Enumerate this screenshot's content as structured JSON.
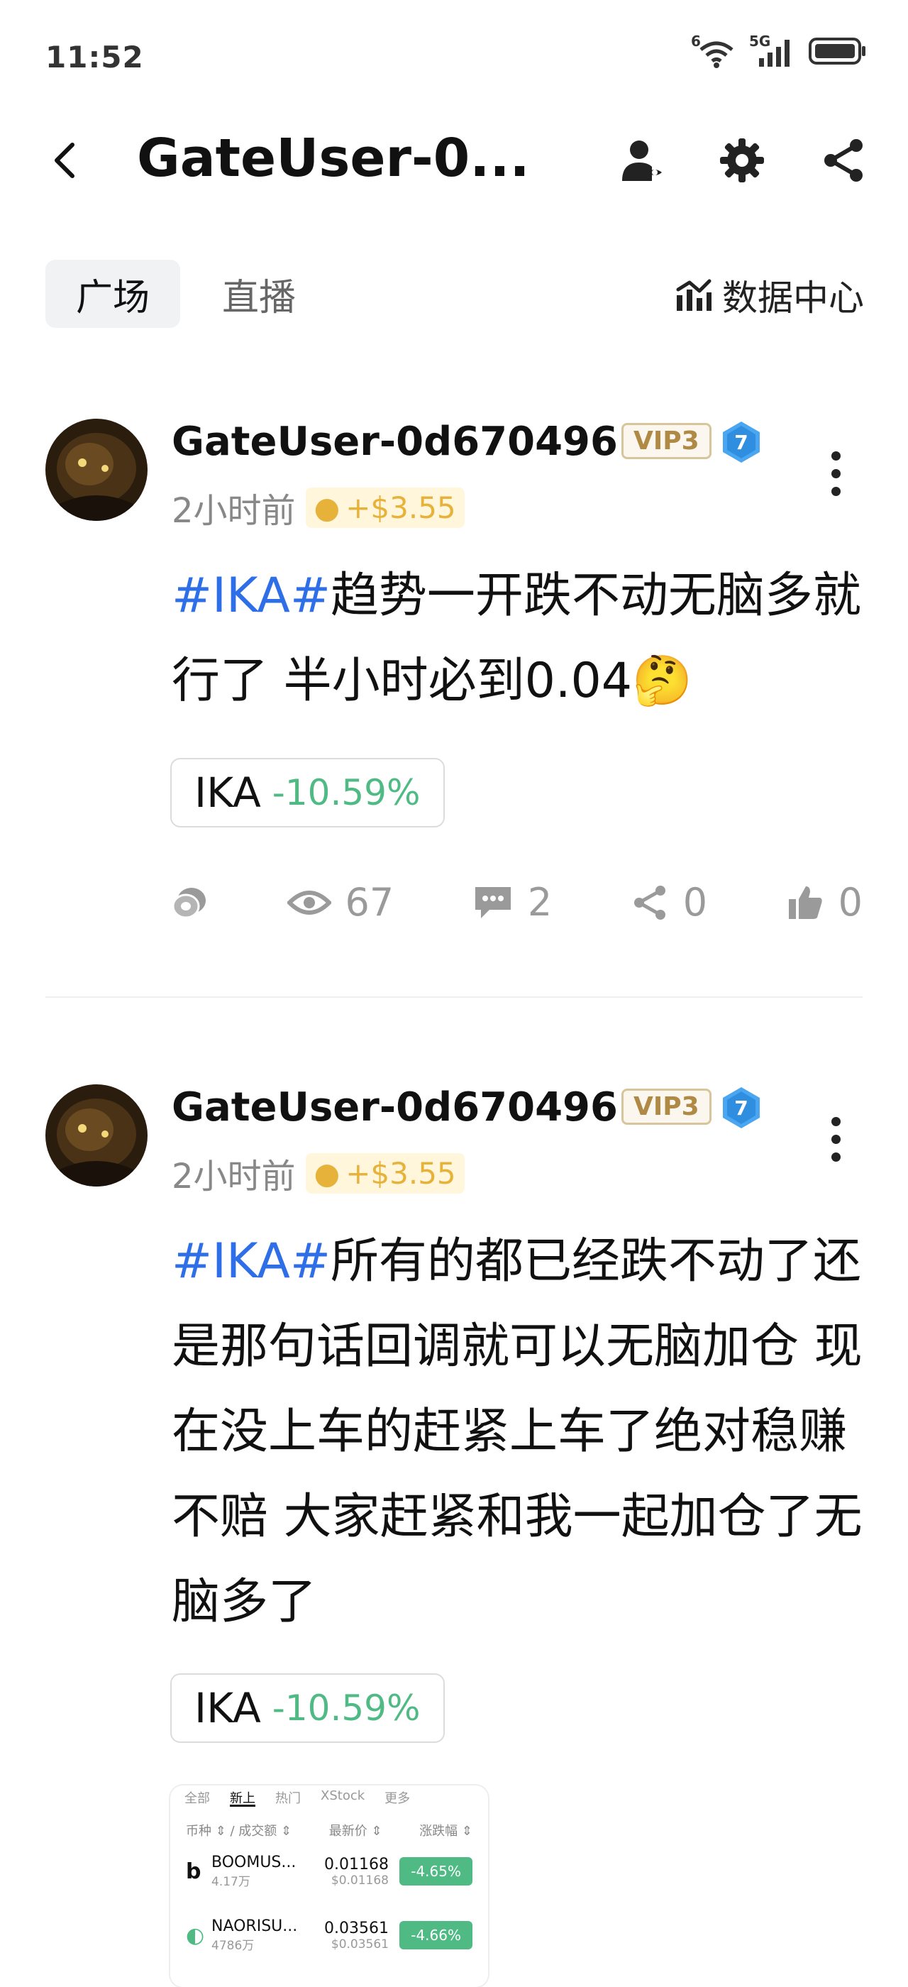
{
  "status": {
    "time": "11:52",
    "net1": "6",
    "net2": "5G"
  },
  "header": {
    "title": "GateUser-0..."
  },
  "tabs": [
    {
      "label": "广场"
    },
    {
      "label": "直播"
    }
  ],
  "data_center": {
    "label": "数据中心"
  },
  "posts": [
    {
      "username": "GateUser-0d670496",
      "vip": "VIP3",
      "level": "7",
      "time": "2小时前",
      "tip": "+$3.55",
      "hashtag": "#IKA#",
      "text": "趋势一开跌不动无脑多就行了 半小时必到0.04",
      "emoji": "🤔",
      "coin": {
        "name": "IKA",
        "change": "-10.59%"
      },
      "views": "67",
      "comments": "2",
      "shares": "0",
      "likes": "0"
    },
    {
      "username": "GateUser-0d670496",
      "vip": "VIP3",
      "level": "7",
      "time": "2小时前",
      "tip": "+$3.55",
      "hashtag": "#IKA#",
      "text": "所有的都已经跌不动了还是那句话回调就可以无脑加仓 现在没上车的赶紧上车了绝对稳赚不赔 大家赶紧和我一起加仓了无脑多了",
      "coin": {
        "name": "IKA",
        "change": "-10.59%"
      }
    }
  ],
  "thumbnail": {
    "tabs": [
      "全部",
      "新上",
      "热门",
      "XStock",
      "更多"
    ],
    "header": {
      "col1": "币种 ⇕ / 成交额 ⇕",
      "col2": "最新价 ⇕",
      "col3": "涨跌幅 ⇕"
    },
    "rows": [
      {
        "logo": "b",
        "name": "BOOMUS...",
        "vol": "4.17万",
        "price": "0.01168",
        "sub": "$0.01168",
        "change": "-4.65%"
      },
      {
        "logo": "◐",
        "name": "NAORISU...",
        "vol": "4786万",
        "price": "0.03561",
        "sub": "$0.03561",
        "change": "-4.66%"
      }
    ]
  }
}
